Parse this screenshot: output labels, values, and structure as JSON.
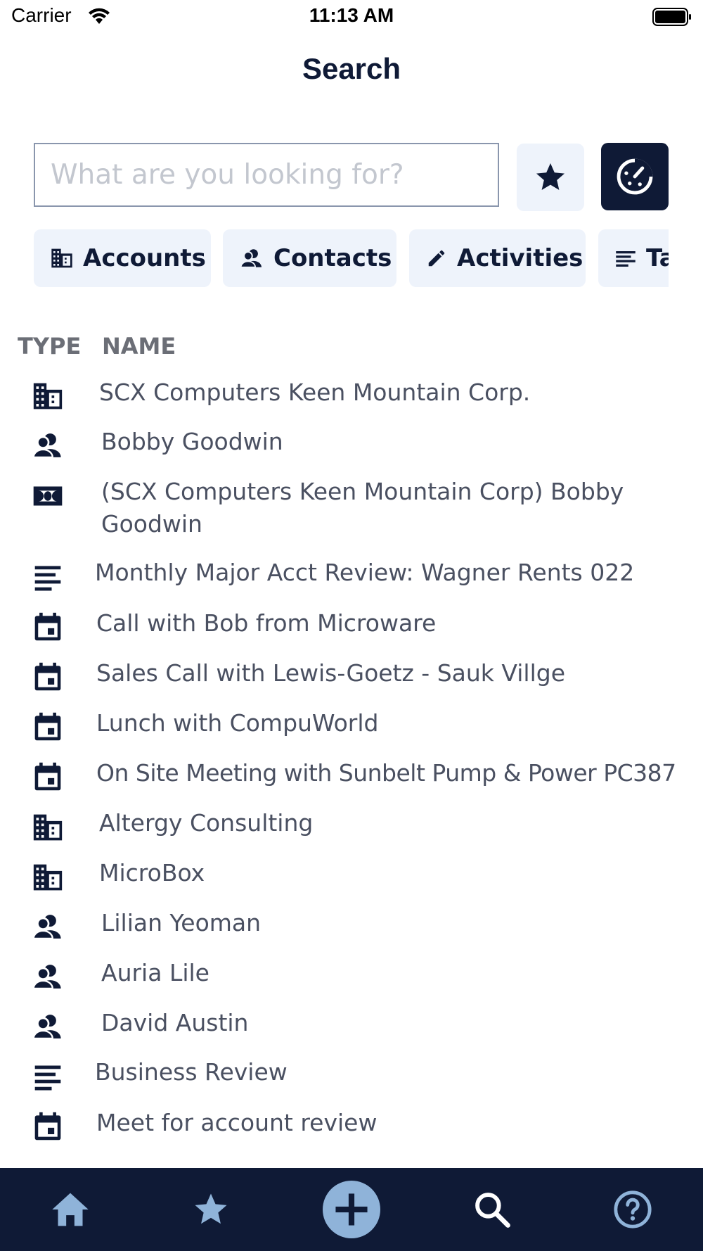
{
  "status": {
    "carrier": "Carrier",
    "time": "11:13 AM"
  },
  "header": {
    "title": "Search"
  },
  "search": {
    "placeholder": "What are you looking for?",
    "value": ""
  },
  "filters": [
    {
      "label": "Accounts",
      "icon": "building-icon"
    },
    {
      "label": "Contacts",
      "icon": "contacts-icon"
    },
    {
      "label": "Activities",
      "icon": "pencil-icon"
    },
    {
      "label": "Tasks",
      "icon": "lines-icon"
    }
  ],
  "columns": {
    "type": "TYPE",
    "name": "NAME"
  },
  "results": [
    {
      "type": "account",
      "icon": "building-icon",
      "name": "SCX Computers Keen Mountain Corp."
    },
    {
      "type": "contact",
      "icon": "contacts-icon",
      "name": "Bobby Goodwin"
    },
    {
      "type": "opportunity",
      "icon": "money-icon",
      "name": "(SCX Computers Keen Mountain Corp) Bobby Goodwin"
    },
    {
      "type": "task",
      "icon": "lines-icon",
      "name": "Monthly Major Acct Review: Wagner Rents 022"
    },
    {
      "type": "appointment",
      "icon": "calendar-icon",
      "name": "Call with Bob from Microware"
    },
    {
      "type": "appointment",
      "icon": "calendar-icon",
      "name": "Sales Call with Lewis-Goetz - Sauk Villge"
    },
    {
      "type": "appointment",
      "icon": "calendar-icon",
      "name": "Lunch with CompuWorld"
    },
    {
      "type": "appointment",
      "icon": "calendar-icon",
      "name": "On Site Meeting with Sunbelt Pump & Power PC387"
    },
    {
      "type": "account",
      "icon": "building-icon",
      "name": "Altergy Consulting"
    },
    {
      "type": "account",
      "icon": "building-icon",
      "name": "MicroBox"
    },
    {
      "type": "contact",
      "icon": "contacts-icon",
      "name": "Lilian Yeoman"
    },
    {
      "type": "contact",
      "icon": "contacts-icon",
      "name": "Auria Lile"
    },
    {
      "type": "contact",
      "icon": "contacts-icon",
      "name": "David Austin"
    },
    {
      "type": "task",
      "icon": "lines-icon",
      "name": "Business Review"
    },
    {
      "type": "appointment",
      "icon": "calendar-icon",
      "name": "Meet for account review"
    }
  ],
  "tabbar": [
    {
      "icon": "home-icon"
    },
    {
      "icon": "star-icon"
    },
    {
      "icon": "plus-icon"
    },
    {
      "icon": "search-icon"
    },
    {
      "icon": "help-icon"
    }
  ],
  "colors": {
    "navy": "#0f1a36",
    "chip_bg": "#eef3fb",
    "tab_icon": "#8fb3d9",
    "row_text": "#4a5061"
  }
}
